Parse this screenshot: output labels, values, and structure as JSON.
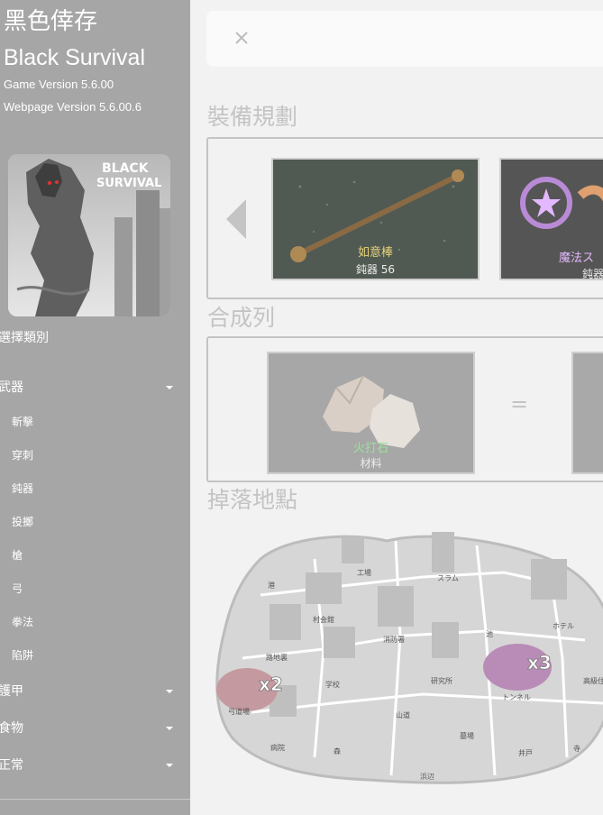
{
  "sidebar": {
    "title": "黑色倖存",
    "subtitle": "Black Survival",
    "game_version": "Game Version 5.6.00",
    "web_version": "Webpage Version 5.6.00.6",
    "cover_logo_line1": "BLACK",
    "cover_logo_line2": "SURVIVAL",
    "category_header": "選擇類別",
    "weapons": "武器",
    "weapon_items": [
      "斬擊",
      "穿刺",
      "鈍器",
      "投擲",
      "槍",
      "弓",
      "拳法",
      "陷阱"
    ],
    "armor": "護甲",
    "food": "食物",
    "misc": "正常"
  },
  "main": {
    "sections": {
      "equipment": "裝備規劃",
      "synthesis": "合成列",
      "drop": "掉落地點"
    },
    "equipment_cards": [
      {
        "name": "如意棒",
        "meta": "鈍器 56",
        "name_color": "#e8d27a"
      },
      {
        "name": "魔法ス",
        "meta": "鈍器",
        "name_color": "#e3b8ff"
      }
    ],
    "synthesis_cards": [
      {
        "name": "火打石",
        "meta": "材料",
        "name_color": "#9be39b"
      }
    ],
    "synthesis_operator": "=",
    "map": {
      "labels": [
        "港",
        "工場",
        "スラム",
        "ホテル",
        "村会館",
        "消防署",
        "池",
        "路地裏",
        "学校",
        "研究所",
        "高級住",
        "弓道場",
        "山道",
        "トンネル",
        "病院",
        "森",
        "墓場",
        "井戸",
        "寺",
        "浜辺"
      ],
      "markers": [
        "x2",
        "x3"
      ]
    }
  }
}
